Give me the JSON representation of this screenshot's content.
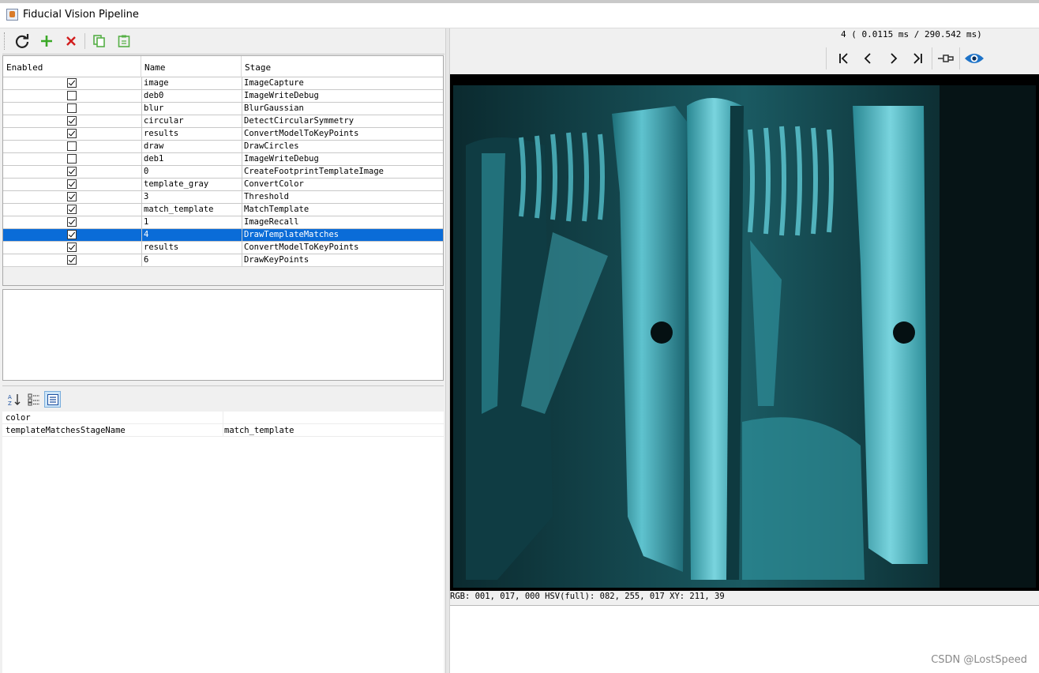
{
  "window": {
    "title": "Fiducial Vision Pipeline"
  },
  "toolbar": {
    "icons": [
      "refresh-icon",
      "add-icon",
      "delete-icon",
      "copy-icon",
      "paste-icon"
    ],
    "colors": {
      "refresh": "#222222",
      "add": "#3aa826",
      "delete": "#d21e1e",
      "copy": "#56b046",
      "paste": "#56b046"
    }
  },
  "table": {
    "headers": {
      "enabled": "Enabled",
      "name": "Name",
      "stage": "Stage"
    },
    "rows": [
      {
        "enabled": true,
        "name": "image",
        "stage": "ImageCapture"
      },
      {
        "enabled": false,
        "name": "deb0",
        "stage": "ImageWriteDebug"
      },
      {
        "enabled": false,
        "name": "blur",
        "stage": "BlurGaussian"
      },
      {
        "enabled": true,
        "name": "circular",
        "stage": "DetectCircularSymmetry"
      },
      {
        "enabled": true,
        "name": "results",
        "stage": "ConvertModelToKeyPoints"
      },
      {
        "enabled": false,
        "name": "draw",
        "stage": "DrawCircles"
      },
      {
        "enabled": false,
        "name": "deb1",
        "stage": "ImageWriteDebug"
      },
      {
        "enabled": true,
        "name": "0",
        "stage": "CreateFootprintTemplateImage"
      },
      {
        "enabled": true,
        "name": "template_gray",
        "stage": "ConvertColor"
      },
      {
        "enabled": true,
        "name": "3",
        "stage": "Threshold"
      },
      {
        "enabled": true,
        "name": "match_template",
        "stage": "MatchTemplate"
      },
      {
        "enabled": true,
        "name": "1",
        "stage": "ImageRecall"
      },
      {
        "enabled": true,
        "name": "4",
        "stage": "DrawTemplateMatches",
        "selected": true
      },
      {
        "enabled": true,
        "name": "results",
        "stage": "ConvertModelToKeyPoints"
      },
      {
        "enabled": true,
        "name": "6",
        "stage": "DrawKeyPoints"
      }
    ],
    "selected_color": "#0a6cd8"
  },
  "properties": {
    "toolbar_icons": [
      "sort-alpha-icon",
      "categorized-icon",
      "property-list-icon"
    ],
    "rows": [
      {
        "key": "color",
        "value": ""
      },
      {
        "key": "templateMatchesStageName",
        "value": "match_template"
      }
    ]
  },
  "viewer": {
    "timing": "4 ( 0.0115 ms / 290.542 ms)",
    "nav_icons": [
      "first-frame-icon",
      "prev-frame-icon",
      "next-frame-icon",
      "last-frame-icon",
      "pin-icon",
      "eye-icon"
    ],
    "status": "RGB: 001, 017, 000 HSV(full): 082, 255, 017 XY: 211, 39",
    "image_tint": "#3fb0bd"
  },
  "watermark": "CSDN @LostSpeed"
}
